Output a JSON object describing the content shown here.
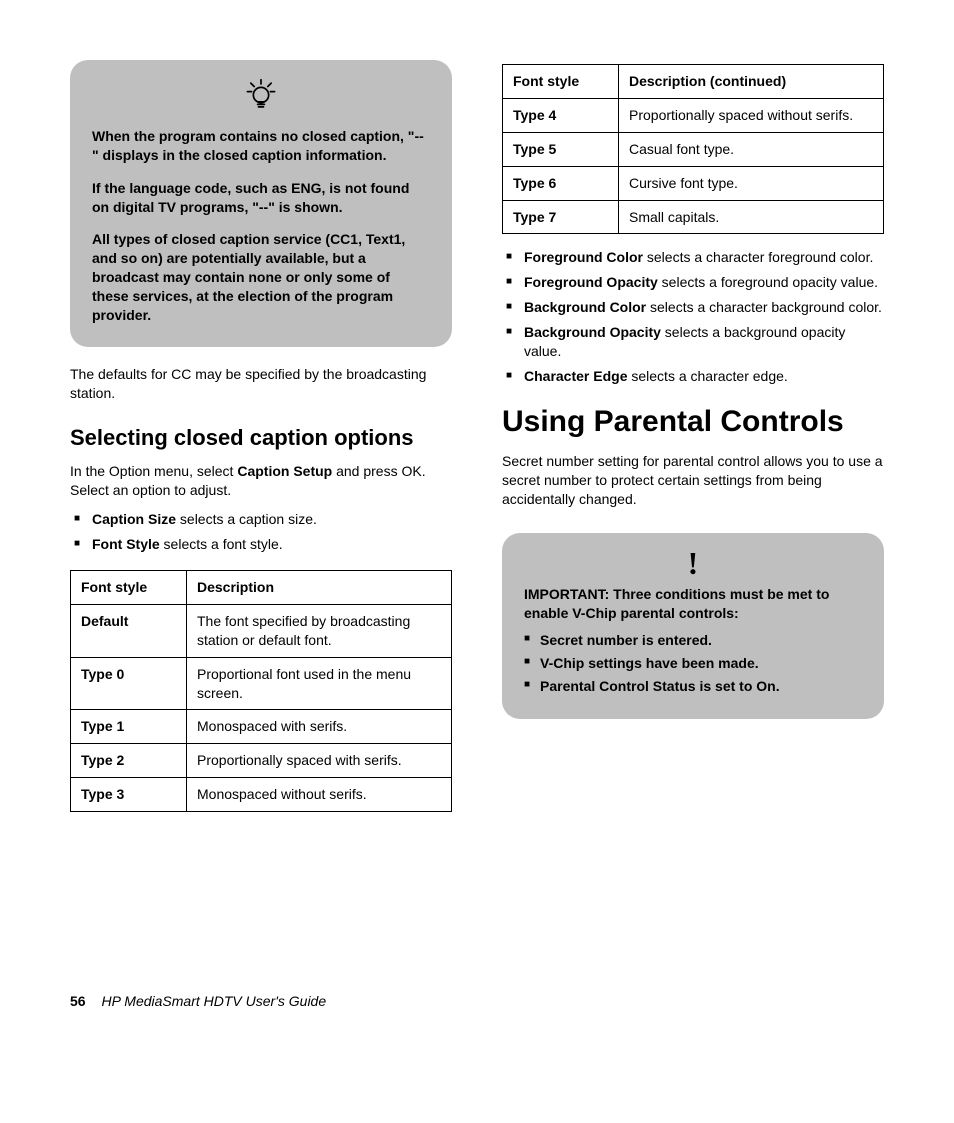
{
  "tipBox": {
    "p1": "When the program contains no closed caption, \"--\" displays in the closed caption information.",
    "p2": "If the language code, such as ENG, is not found on digital TV programs, \"--\" is shown.",
    "p3": "All types of closed caption service (CC1, Text1, and so on) are potentially available, but a broadcast may contain none or only some of these services, at the election of the program provider."
  },
  "defaultsText": "The defaults for CC may be specified by the broadcasting station.",
  "section1": {
    "heading": "Selecting closed caption options",
    "intro_pre": "In the Option menu, select ",
    "intro_bold": "Caption Setup",
    "intro_post": " and press OK. Select an option to adjust.",
    "bullets": [
      {
        "bold": "Caption Size",
        "rest": " selects a caption size."
      },
      {
        "bold": "Font Style",
        "rest": " selects a font style."
      }
    ]
  },
  "table1": {
    "h1": "Font style",
    "h2": "Description",
    "rows": [
      {
        "a": "Default",
        "b": "The font specified by broadcasting station or default font."
      },
      {
        "a": "Type 0",
        "b": "Proportional font used in the menu screen."
      },
      {
        "a": "Type 1",
        "b": "Monospaced with serifs."
      },
      {
        "a": "Type 2",
        "b": "Proportionally spaced with serifs."
      },
      {
        "a": "Type 3",
        "b": "Monospaced without serifs."
      }
    ]
  },
  "table2": {
    "h1": "Font style",
    "h2": "Description (continued)",
    "rows": [
      {
        "a": "Type 4",
        "b": "Proportionally spaced without serifs."
      },
      {
        "a": "Type 5",
        "b": "Casual font type."
      },
      {
        "a": "Type 6",
        "b": "Cursive font type."
      },
      {
        "a": "Type 7",
        "b": "Small capitals."
      }
    ]
  },
  "bullets2": [
    {
      "bold": "Foreground Color",
      "rest": " selects a character foreground color."
    },
    {
      "bold": "Foreground Opacity",
      "rest": " selects a foreground opacity value."
    },
    {
      "bold": "Background Color",
      "rest": " selects a character background color."
    },
    {
      "bold": "Background Opacity",
      "rest": " selects a background opacity value."
    },
    {
      "bold": "Character Edge",
      "rest": " selects a character edge."
    }
  ],
  "section2": {
    "heading": "Using Parental Controls",
    "intro": "Secret number setting for parental control allows you to use a secret number to protect certain settings from being accidentally changed."
  },
  "importantBox": {
    "title": "IMPORTANT: Three conditions must be met to enable V-Chip parental controls:",
    "items": [
      "Secret number is entered.",
      "V-Chip settings have been made.",
      "Parental Control Status is set to On."
    ]
  },
  "footer": {
    "page": "56",
    "title": "HP MediaSmart HDTV User's Guide"
  }
}
